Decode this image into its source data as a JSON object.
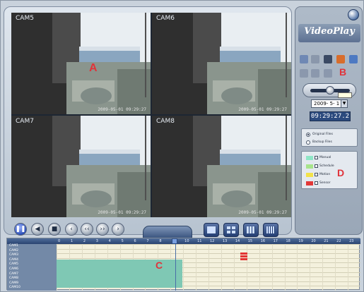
{
  "app": {
    "logo": "VideoPlay"
  },
  "cameras": [
    {
      "label": "CAM5",
      "timestamp": "2009-05-01 09:29:27"
    },
    {
      "label": "CAM6",
      "timestamp": "2009-05-01 09:29:27"
    },
    {
      "label": "CAM7",
      "timestamp": "2009-05-01 09:29:27"
    },
    {
      "label": "CAM8",
      "timestamp": "2009-05-01 09:29:27"
    }
  ],
  "markers": {
    "a": "A",
    "b": "B",
    "c": "C",
    "d": "D"
  },
  "controls": {
    "center_tab": "",
    "buttons": [
      "pause",
      "rewind",
      "stop",
      "prev-frame",
      "slow",
      "fast",
      "next-frame"
    ]
  },
  "right_panel": {
    "slider_tip": "",
    "date_value": "2009- 5- 1",
    "time_value": "09:29:27.2",
    "file_options": [
      "Original Files",
      "Backup Files"
    ],
    "legend": [
      {
        "label": "Manual",
        "color": "#8fe6c6"
      },
      {
        "label": "Schedule",
        "color": "#a8e48c"
      },
      {
        "label": "Motion",
        "color": "#f2e24a"
      },
      {
        "label": "Sensor",
        "color": "#e23838"
      }
    ]
  },
  "timeline": {
    "hours": [
      "0",
      "1",
      "2",
      "3",
      "4",
      "5",
      "6",
      "7",
      "8",
      "9",
      "10",
      "11",
      "12",
      "13",
      "14",
      "15",
      "16",
      "17",
      "18",
      "19",
      "20",
      "21",
      "22",
      "23"
    ],
    "channels": [
      "CAM1",
      "CAM2",
      "CAM3",
      "CAM4",
      "CAM5",
      "CAM6",
      "CAM7",
      "CAM8",
      "CAM9",
      "CAM10"
    ]
  }
}
